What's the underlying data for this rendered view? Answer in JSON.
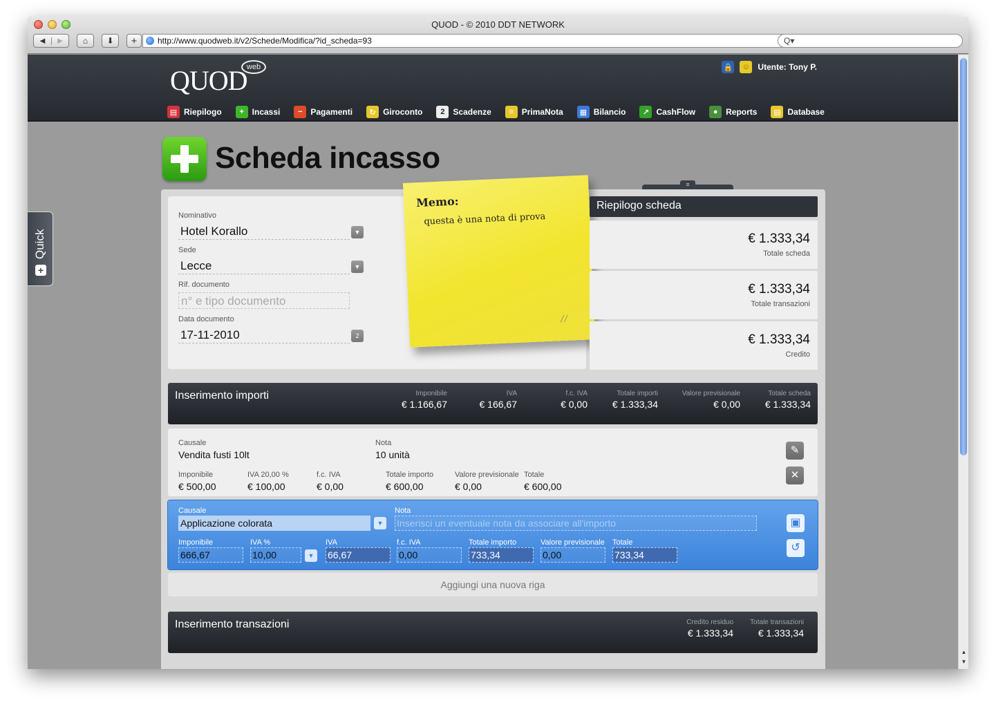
{
  "browser": {
    "title": "QUOD - © 2010 DDT NETWORK",
    "url": "http://www.quodweb.it/v2/Schede/Modifica/?id_scheda=93",
    "search_icon": "Q▾"
  },
  "app": {
    "logo": "QUOD",
    "logo_badge": "web",
    "user": "Utente: Tony P."
  },
  "nav": [
    {
      "label": "Riepilogo",
      "color": "#d8323a",
      "icon": "▤"
    },
    {
      "label": "Incassi",
      "color": "#3fb52a",
      "icon": "+"
    },
    {
      "label": "Pagamenti",
      "color": "#e04a2a",
      "icon": "−"
    },
    {
      "label": "Giroconto",
      "color": "#e8c72c",
      "icon": "↻"
    },
    {
      "label": "Scadenze",
      "color": "#eeeeee",
      "icon": "2"
    },
    {
      "label": "PrimaNota",
      "color": "#e8c72c",
      "icon": "≡"
    },
    {
      "label": "Bilancio",
      "color": "#3d7ad6",
      "icon": "▦"
    },
    {
      "label": "CashFlow",
      "color": "#36a12a",
      "icon": "↗"
    },
    {
      "label": "Reports",
      "color": "#4a8f3c",
      "icon": "●"
    },
    {
      "label": "Database",
      "color": "#e8c72c",
      "icon": "▤"
    }
  ],
  "quick": {
    "label": "Quick"
  },
  "page": {
    "title": "Scheda incasso"
  },
  "form": {
    "nominativo": {
      "label": "Nominativo",
      "value": "Hotel Korallo"
    },
    "sede": {
      "label": "Sede",
      "value": "Lecce"
    },
    "rif": {
      "label": "Rif. documento",
      "placeholder": "n° e tipo documento"
    },
    "data": {
      "label": "Data documento",
      "value": "17-11-2010",
      "btn": "2"
    }
  },
  "memo": {
    "title": "Memo:",
    "text": "questa è una nota di prova"
  },
  "riepilogo": {
    "title": "Riepilogo scheda",
    "cards": [
      {
        "value": "€ 1.333,34",
        "label": "Totale scheda"
      },
      {
        "value": "€ 1.333,34",
        "label": "Totale transazioni"
      },
      {
        "value": "€ 1.333,34",
        "label": "Credito"
      }
    ]
  },
  "importi": {
    "title": "Inserimento importi",
    "summary": [
      {
        "label": "Imponibile",
        "value": "€ 1.166,67"
      },
      {
        "label": "IVA",
        "value": "€ 166,67"
      },
      {
        "label": "f.c. IVA",
        "value": "€ 0,00"
      },
      {
        "label": "Totale importi",
        "value": "€ 1.333,34"
      },
      {
        "label": "Valore previsionale",
        "value": "€ 0,00"
      },
      {
        "label": "Totale scheda",
        "value": "€ 1.333,34"
      }
    ]
  },
  "row1": {
    "causale_label": "Causale",
    "causale": "Vendita fusti 10lt",
    "nota_label": "Nota",
    "nota": "10 unità",
    "imponibile_label": "Imponibile",
    "imponibile": "€ 500,00",
    "iva_label": "IVA 20,00 %",
    "iva": "€ 100,00",
    "fciva_label": "f.c. IVA",
    "fciva": "€ 0,00",
    "totale_importo_label": "Totale importo",
    "totale_importo": "€ 600,00",
    "valore_label": "Valore previsionale",
    "valore": "€ 0,00",
    "totale_label": "Totale",
    "totale": "€ 600,00"
  },
  "edit": {
    "causale_label": "Causale",
    "causale": "Applicazione colorata",
    "nota_label": "Nota",
    "nota_placeholder": "Inserisci un eventuale nota da associare all'importo",
    "imponibile_label": "Imponibile",
    "imponibile": "666,67",
    "ivap_label": "IVA %",
    "ivap": "10,00",
    "iva_label": "IVA",
    "iva": "66,67",
    "fciva_label": "f.c. IVA",
    "fciva": "0,00",
    "totale_importo_label": "Totale importo",
    "totale_importo": "733,34",
    "valore_label": "Valore previsionale",
    "valore": "0,00",
    "totale_label": "Totale",
    "totale": "733,34"
  },
  "add_row": "Aggiungi una nuova riga",
  "transazioni": {
    "title": "Inserimento transazioni",
    "summary": [
      {
        "label": "Credito residuo",
        "value": "€ 1.333,34"
      },
      {
        "label": "Totale transazioni",
        "value": "€ 1.333,34"
      }
    ]
  }
}
